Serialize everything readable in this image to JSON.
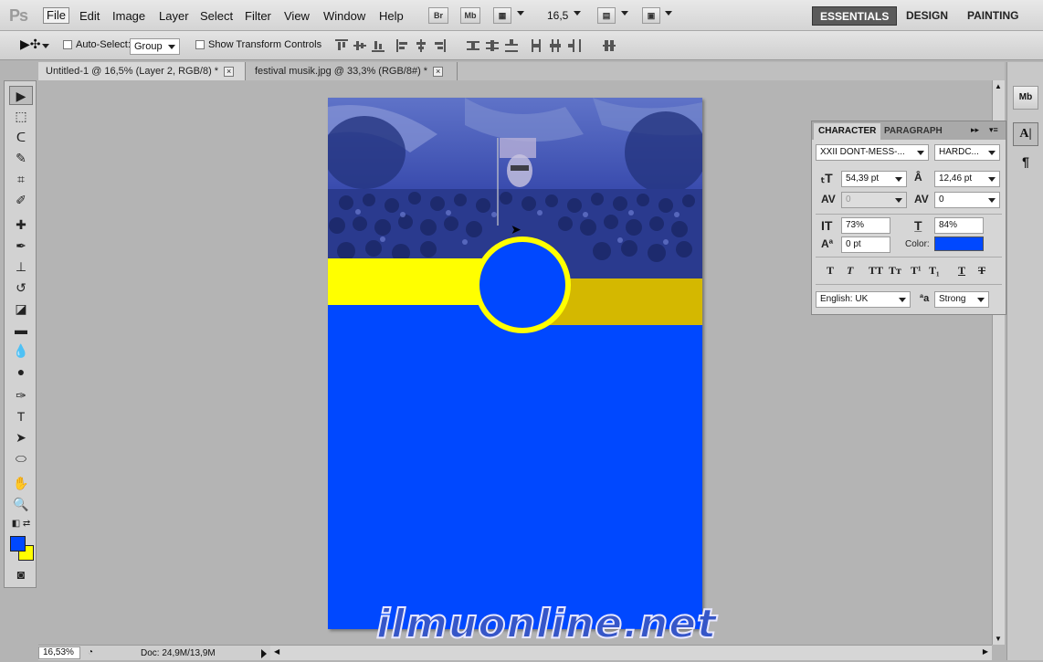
{
  "app": {
    "logo": "Ps"
  },
  "menu": [
    "File",
    "Edit",
    "Image",
    "Layer",
    "Select",
    "Filter",
    "View",
    "Window",
    "Help"
  ],
  "appbar": {
    "bridge": "Br",
    "minibridge": "Mb",
    "zoom": "16,5"
  },
  "workspaces": [
    "ESSENTIALS",
    "DESIGN",
    "PAINTING"
  ],
  "options": {
    "auto_select_label": "Auto-Select:",
    "auto_select_value": "Group",
    "transform_label": "Show Transform Controls"
  },
  "tabs": [
    {
      "label": "Untitled-1 @ 16,5% (Layer 2, RGB/8) *",
      "close": "×"
    },
    {
      "label": "festival musik.jpg @ 33,3% (RGB/8#) *",
      "close": "×"
    }
  ],
  "status": {
    "zoom": "16,53%",
    "doc": "Doc: 24,9M/13,9M"
  },
  "watermark": "ilmuonline.net",
  "character": {
    "tabs": [
      "CHARACTER",
      "PARAGRAPH"
    ],
    "font_family": "XXII DONT-MESS-...",
    "font_style": "HARDC...",
    "size": "54,39 pt",
    "leading": "12,46 pt",
    "kerning": "0",
    "tracking": "0",
    "vscale": "73%",
    "hscale": "84%",
    "baseline": "0 pt",
    "color_label": "Color:",
    "text_color": "#0048ff",
    "language": "English: UK",
    "antialias_icon": "ªa",
    "antialias": "Strong"
  },
  "colors": {
    "foreground": "#0048ff",
    "background": "#ffff00",
    "band_yellow": "#ffff00",
    "band_gold": "#d4b800"
  }
}
